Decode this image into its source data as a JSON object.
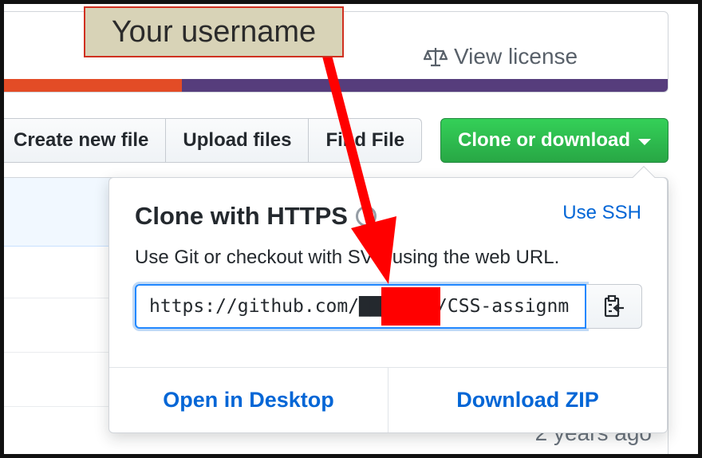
{
  "license": {
    "label": "View license",
    "icon": "scale-icon"
  },
  "language_bar": [
    {
      "color": "#e34c26",
      "share": 0.28
    },
    {
      "color": "#563d7c",
      "share": 0.72
    }
  ],
  "toolbar": {
    "create_file": "Create new file",
    "upload_files": "Upload files",
    "find_file": "Find File",
    "clone_download": "Clone or download"
  },
  "clone_dropdown": {
    "title": "Clone with HTTPS",
    "switch_protocol": "Use SSH",
    "description": "Use Git or checkout with SVN using the web URL.",
    "url_value": "https://github.com/███████/CSS-assignm",
    "open_desktop": "Open in Desktop",
    "download_zip": "Download ZIP"
  },
  "file_list": {
    "age": "2 years ago"
  },
  "annotation": {
    "callout": "Your username",
    "arrow_color": "#ff0000"
  },
  "colors": {
    "accent_green": "#28a745",
    "link_blue": "#0366d6",
    "redaction": "#ff0000"
  }
}
